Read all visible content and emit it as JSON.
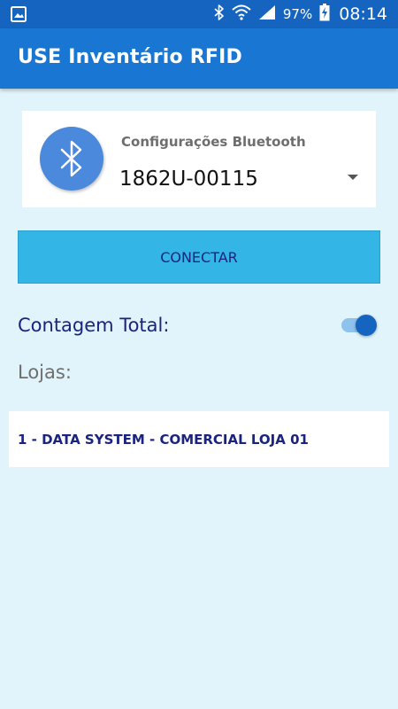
{
  "status_bar": {
    "left_icon": "image-icon",
    "icons": [
      "bluetooth-icon",
      "wifi-icon",
      "signal-icon",
      "battery-charging-icon"
    ],
    "battery_percent": "97%",
    "time": "08:14"
  },
  "app_bar": {
    "title": "USE Inventário RFID"
  },
  "bluetooth": {
    "icon": "bluetooth-icon",
    "label": "Configurações Bluetooth",
    "selected_device": "1862U-00115"
  },
  "connect_button": {
    "label": "CONECTAR"
  },
  "contagem_total": {
    "label": "Contagem Total:",
    "enabled": true
  },
  "lojas": {
    "label": "Lojas:",
    "items": [
      {
        "label": "1 - DATA SYSTEM - COMERCIAL LOJA 01"
      }
    ]
  },
  "colors": {
    "status_bar": "#1565c0",
    "app_bar": "#1976d2",
    "background": "#e1f4fc",
    "button": "#33b5e5",
    "text_dark_blue": "#1a237e",
    "bluetooth_circle": "#4a89dc"
  }
}
